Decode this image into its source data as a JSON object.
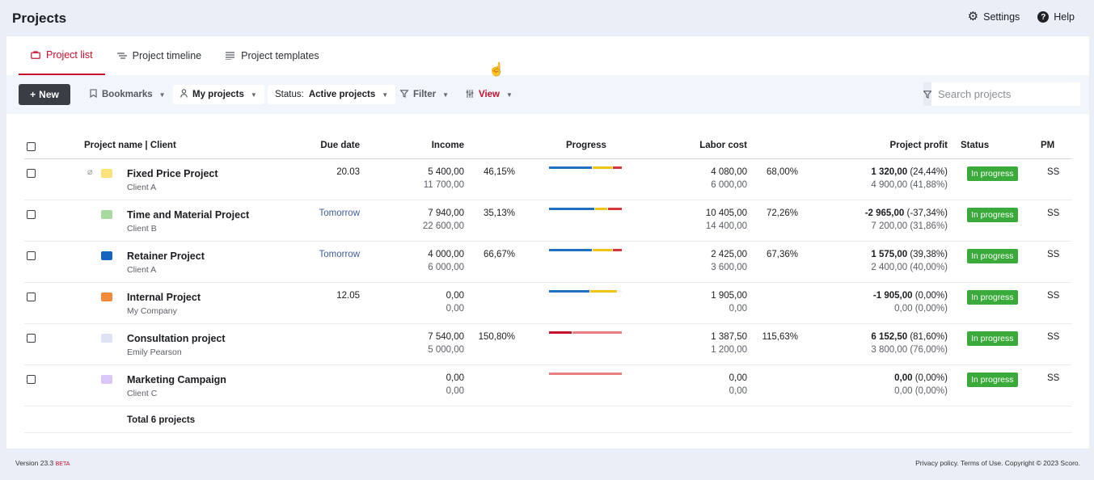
{
  "header": {
    "title": "Projects",
    "settings_label": "Settings",
    "help_label": "Help"
  },
  "tabs": [
    {
      "label": "Project list",
      "active": true
    },
    {
      "label": "Project timeline",
      "active": false
    },
    {
      "label": "Project templates",
      "active": false
    }
  ],
  "toolbar": {
    "new_label": "New",
    "bookmarks_label": "Bookmarks",
    "my_projects_label": "My projects",
    "status_prefix": "Status:",
    "status_value": "Active projects",
    "filter_label": "Filter",
    "view_label": "View",
    "search_placeholder": "Search projects"
  },
  "columns": {
    "name": "Project name | Client",
    "due": "Due date",
    "income": "Income",
    "progress": "Progress",
    "labor": "Labor cost",
    "profit": "Project profit",
    "status": "Status",
    "pm": "PM"
  },
  "rows": [
    {
      "name": "Fixed Price Project",
      "client": "Client A",
      "folder_color": "#fbe27a",
      "due": "20.03",
      "income1": "5 400,00",
      "income2": "11 700,00",
      "income_pct": "46,15%",
      "progress": [
        {
          "c": "#1f70c1",
          "w": 0.6
        },
        {
          "c": "#f0c419",
          "w": 0.27
        },
        {
          "c": "#d9343a",
          "w": 0.13
        }
      ],
      "labor1": "4 080,00",
      "labor2": "6 000,00",
      "labor_pct": "68,00%",
      "profit_main": "1 320,00",
      "profit_pct": "(24,44%)",
      "profit2": "4 900,00 (41,88%)",
      "status": "In progress",
      "pm": "SS"
    },
    {
      "name": "Time and Material Project",
      "client": "Client B",
      "folder_color": "#a8d9a0",
      "due": "Tomorrow",
      "income1": "7 940,00",
      "income2": "22 600,00",
      "income_pct": "35,13%",
      "progress": [
        {
          "c": "#1f70c1",
          "w": 0.64
        },
        {
          "c": "#f0c419",
          "w": 0.17
        },
        {
          "c": "#d9343a",
          "w": 0.19
        }
      ],
      "labor1": "10 405,00",
      "labor2": "14 400,00",
      "labor_pct": "72,26%",
      "profit_main": "-2 965,00",
      "profit_pct": "(-37,34%)",
      "profit2": "7 200,00 (31,86%)",
      "status": "In progress",
      "pm": "SS"
    },
    {
      "name": "Retainer Project",
      "client": "Client A",
      "folder_color": "#1565c0",
      "due": "Tomorrow",
      "income1": "4 000,00",
      "income2": "6 000,00",
      "income_pct": "66,67%",
      "progress": [
        {
          "c": "#1f70c1",
          "w": 0.6
        },
        {
          "c": "#f0c419",
          "w": 0.27
        },
        {
          "c": "#d9343a",
          "w": 0.13
        }
      ],
      "labor1": "2 425,00",
      "labor2": "3 600,00",
      "labor_pct": "67,36%",
      "profit_main": "1 575,00",
      "profit_pct": "(39,38%)",
      "profit2": "2 400,00 (40,00%)",
      "status": "In progress",
      "pm": "SS"
    },
    {
      "name": "Internal Project",
      "client": "My Company",
      "folder_color": "#f28a3a",
      "due": "12.05",
      "income1": "0,00",
      "income2": "0,00",
      "income_pct": "",
      "progress": [
        {
          "c": "#1f70c1",
          "w": 0.57
        },
        {
          "c": "#f0c419",
          "w": 0.37
        },
        {
          "c": "#f2f2f2",
          "w": 0.06
        }
      ],
      "labor1": "1 905,00",
      "labor2": "0,00",
      "labor_pct": "",
      "profit_main": "-1 905,00",
      "profit_pct": "(0,00%)",
      "profit2": "0,00 (0,00%)",
      "status": "In progress",
      "pm": "SS"
    },
    {
      "name": "Consultation project",
      "client": "Emily Pearson",
      "folder_color": "#dde3f2",
      "due": "",
      "income1": "7 540,00",
      "income2": "5 000,00",
      "income_pct": "150,80%",
      "progress": [
        {
          "c": "#c8102e",
          "w": 0.32
        },
        {
          "c": "#e88080",
          "w": 0.68
        }
      ],
      "labor1": "1 387,50",
      "labor2": "1 200,00",
      "labor_pct": "115,63%",
      "profit_main": "6 152,50",
      "profit_pct": "(81,60%)",
      "profit2": "3 800,00 (76,00%)",
      "status": "In progress",
      "pm": "SS"
    },
    {
      "name": "Marketing Campaign",
      "client": "Client C",
      "folder_color": "#d9c8f5",
      "due": "",
      "income1": "0,00",
      "income2": "0,00",
      "income_pct": "",
      "progress": [
        {
          "c": "#e88080",
          "w": 1.0
        }
      ],
      "labor1": "0,00",
      "labor2": "0,00",
      "labor_pct": "",
      "profit_main": "0,00",
      "profit_pct": "(0,00%)",
      "profit2": "0,00 (0,00%)",
      "status": "In progress",
      "pm": "SS"
    }
  ],
  "total_label": "Total 6 projects",
  "footer": {
    "version": "Version 23.3",
    "beta": "BETA",
    "legal": "Privacy policy. Terms of Use. Copyright © 2023 Scoro."
  }
}
